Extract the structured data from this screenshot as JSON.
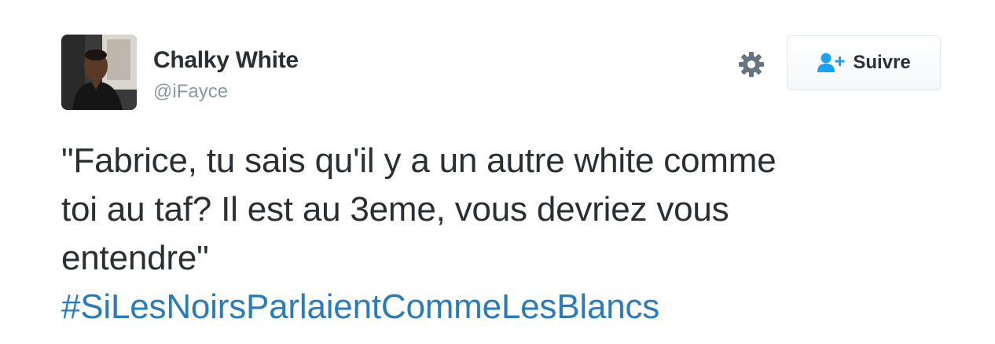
{
  "author": {
    "name": "Chalky White",
    "handle": "@iFayce"
  },
  "actions": {
    "follow_label": "Suivre",
    "settings_icon": "gear-icon",
    "follow_icon": "person-plus-icon"
  },
  "tweet": {
    "lines": [
      "\"Fabrice, tu sais qu'il y a un autre white comme",
      "toi au taf? Il est au 3eme, vous devriez vous",
      "entendre\""
    ],
    "hashtag": "#SiLesNoirsParlaientCommeLesBlancs"
  },
  "colors": {
    "text": "#292f33",
    "muted": "#8899a6",
    "link": "#2b7bb9",
    "follow_icon": "#1da1f2"
  }
}
